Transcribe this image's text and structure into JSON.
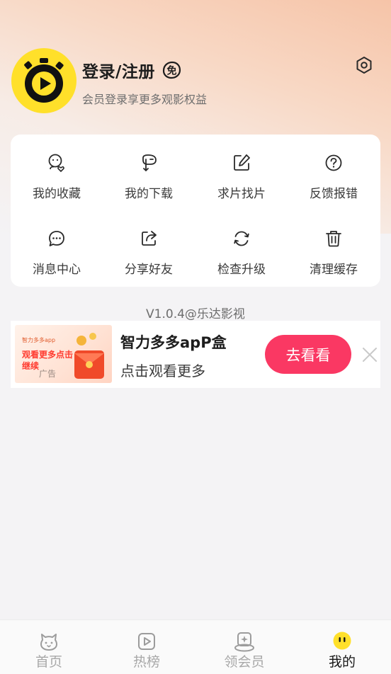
{
  "profile": {
    "login_title": "登录/注册",
    "free_badge": "免",
    "subtitle": "会员登录享更多观影权益"
  },
  "menu": {
    "items": [
      {
        "label": "我的收藏",
        "icon": "favorite-user-icon"
      },
      {
        "label": "我的下载",
        "icon": "download-icon"
      },
      {
        "label": "求片找片",
        "icon": "edit-request-icon"
      },
      {
        "label": "反馈报错",
        "icon": "help-question-icon"
      },
      {
        "label": "消息中心",
        "icon": "message-icon"
      },
      {
        "label": "分享好友",
        "icon": "share-icon"
      },
      {
        "label": "检查升级",
        "icon": "refresh-icon"
      },
      {
        "label": "清理缓存",
        "icon": "trash-icon"
      }
    ]
  },
  "version": "V1.0.4@乐达影视",
  "ad": {
    "title": "智力多多apP盒",
    "description": "点击观看更多",
    "cta": "去看看",
    "image_brand": "智力多多app",
    "image_text": "观看更多点击继续",
    "image_tag": "广告"
  },
  "tabbar": {
    "tabs": [
      {
        "label": "首页",
        "icon": "home-cat-icon"
      },
      {
        "label": "热榜",
        "icon": "play-chart-icon"
      },
      {
        "label": "领会员",
        "icon": "vip-gift-icon"
      },
      {
        "label": "我的",
        "icon": "profile-face-icon"
      }
    ],
    "active_index": 3
  },
  "colors": {
    "accent": "#fa3863",
    "avatar_yellow": "#ffe02a",
    "header_gradient_top": "#f6c4a8"
  }
}
